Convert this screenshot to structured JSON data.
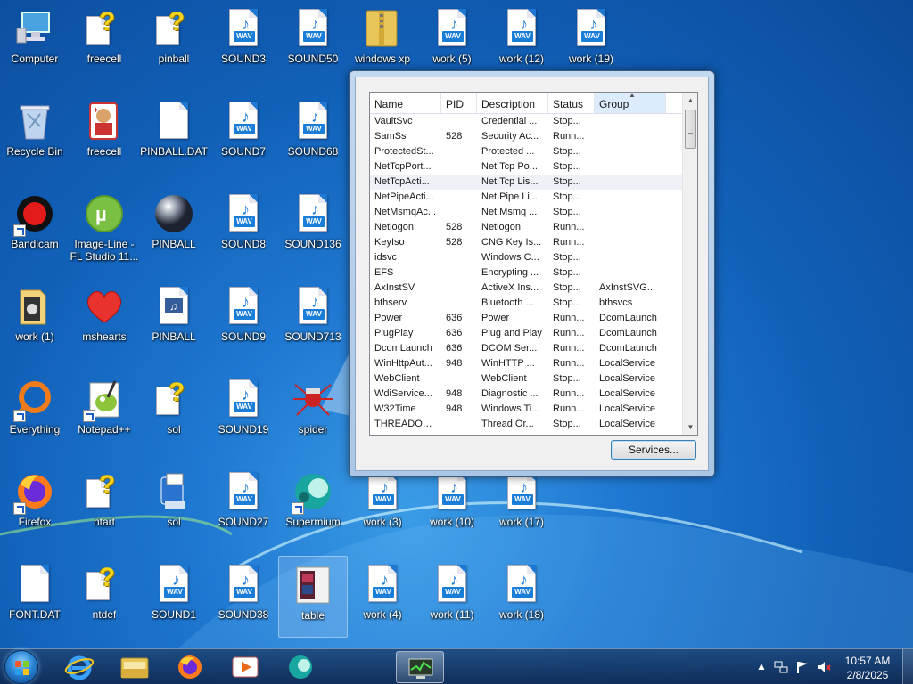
{
  "desktop": {
    "icons": [
      {
        "label": "Computer"
      },
      {
        "label": "freecell"
      },
      {
        "label": "pinball"
      },
      {
        "label": "SOUND3"
      },
      {
        "label": "SOUND50"
      },
      {
        "label": "windows xp"
      },
      {
        "label": "work (5)"
      },
      {
        "label": "work (12)"
      },
      {
        "label": "work (19)"
      },
      {
        "label": "Recycle Bin"
      },
      {
        "label": "freecell"
      },
      {
        "label": "PINBALL.DAT"
      },
      {
        "label": "SOUND7"
      },
      {
        "label": "SOUND68"
      },
      {
        "label": "Bandicam"
      },
      {
        "label": "Image-Line - FL Studio 11..."
      },
      {
        "label": "PINBALL"
      },
      {
        "label": "SOUND8"
      },
      {
        "label": "SOUND136"
      },
      {
        "label": "work (1)"
      },
      {
        "label": "mshearts"
      },
      {
        "label": "PINBALL"
      },
      {
        "label": "SOUND9"
      },
      {
        "label": "SOUND713"
      },
      {
        "label": "Everything"
      },
      {
        "label": "Notepad++"
      },
      {
        "label": "sol"
      },
      {
        "label": "SOUND19"
      },
      {
        "label": "spider"
      },
      {
        "label": "Firefox"
      },
      {
        "label": "ntart"
      },
      {
        "label": "sol"
      },
      {
        "label": "SOUND27"
      },
      {
        "label": "Supermium"
      },
      {
        "label": "work (3)"
      },
      {
        "label": "work (10)"
      },
      {
        "label": "work (17)"
      },
      {
        "label": "FONT.DAT"
      },
      {
        "label": "ntdef"
      },
      {
        "label": "SOUND1"
      },
      {
        "label": "SOUND38"
      },
      {
        "label": "table"
      },
      {
        "label": "work (4)"
      },
      {
        "label": "work (11)"
      },
      {
        "label": "work (18)"
      }
    ],
    "wav_tag": "WAV",
    "shortcut_icon": "shortcut-arrow-icon"
  },
  "task_manager": {
    "columns": {
      "name": "Name",
      "pid": "PID",
      "description": "Description",
      "status": "Status",
      "group": "Group"
    },
    "sorted_column": "Group",
    "rows": [
      {
        "name": "VaultSvc",
        "pid": "",
        "description": "Credential ...",
        "status": "Stop...",
        "group": ""
      },
      {
        "name": "SamSs",
        "pid": "528",
        "description": "Security Ac...",
        "status": "Runn...",
        "group": ""
      },
      {
        "name": "ProtectedSt...",
        "pid": "",
        "description": "Protected ...",
        "status": "Stop...",
        "group": ""
      },
      {
        "name": "NetTcpPort...",
        "pid": "",
        "description": "Net.Tcp Po...",
        "status": "Stop...",
        "group": ""
      },
      {
        "name": "NetTcpActi...",
        "pid": "",
        "description": "Net.Tcp Lis...",
        "status": "Stop...",
        "group": ""
      },
      {
        "name": "NetPipeActi...",
        "pid": "",
        "description": "Net.Pipe Li...",
        "status": "Stop...",
        "group": ""
      },
      {
        "name": "NetMsmqAc...",
        "pid": "",
        "description": "Net.Msmq ...",
        "status": "Stop...",
        "group": ""
      },
      {
        "name": "Netlogon",
        "pid": "528",
        "description": "Netlogon",
        "status": "Runn...",
        "group": ""
      },
      {
        "name": "KeyIso",
        "pid": "528",
        "description": "CNG Key Is...",
        "status": "Runn...",
        "group": ""
      },
      {
        "name": "idsvc",
        "pid": "",
        "description": "Windows C...",
        "status": "Stop...",
        "group": ""
      },
      {
        "name": "EFS",
        "pid": "",
        "description": "Encrypting ...",
        "status": "Stop...",
        "group": ""
      },
      {
        "name": "AxInstSV",
        "pid": "",
        "description": "ActiveX Ins...",
        "status": "Stop...",
        "group": "AxInstSVG..."
      },
      {
        "name": "bthserv",
        "pid": "",
        "description": "Bluetooth ...",
        "status": "Stop...",
        "group": "bthsvcs"
      },
      {
        "name": "Power",
        "pid": "636",
        "description": "Power",
        "status": "Runn...",
        "group": "DcomLaunch"
      },
      {
        "name": "PlugPlay",
        "pid": "636",
        "description": "Plug and Play",
        "status": "Runn...",
        "group": "DcomLaunch"
      },
      {
        "name": "DcomLaunch",
        "pid": "636",
        "description": "DCOM Ser...",
        "status": "Runn...",
        "group": "DcomLaunch"
      },
      {
        "name": "WinHttpAut...",
        "pid": "948",
        "description": "WinHTTP ...",
        "status": "Runn...",
        "group": "LocalService"
      },
      {
        "name": "WebClient",
        "pid": "",
        "description": "WebClient",
        "status": "Stop...",
        "group": "LocalService"
      },
      {
        "name": "WdiService...",
        "pid": "948",
        "description": "Diagnostic ...",
        "status": "Runn...",
        "group": "LocalService"
      },
      {
        "name": "W32Time",
        "pid": "948",
        "description": "Windows Ti...",
        "status": "Runn...",
        "group": "LocalService"
      },
      {
        "name": "THREADOR...",
        "pid": "",
        "description": "Thread Or...",
        "status": "Stop...",
        "group": "LocalService"
      }
    ],
    "highlighted_row": 4,
    "services_button": "Services..."
  },
  "taskbar": {
    "pinned": [
      "internet-explorer-icon",
      "file-explorer-icon",
      "firefox-icon",
      "media-player-icon",
      "supermium-icon",
      "task-manager-icon"
    ],
    "clock_time": "10:57 AM",
    "clock_date": "2/8/2025"
  }
}
